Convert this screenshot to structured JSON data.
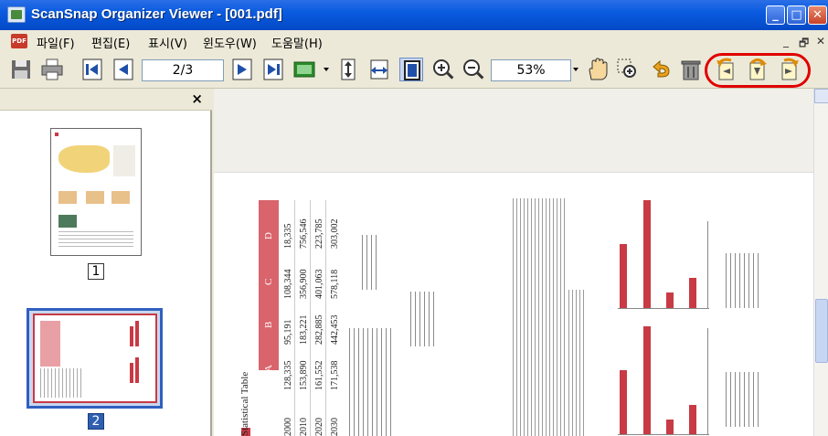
{
  "window": {
    "title": "ScanSnap Organizer Viewer - [001.pdf]",
    "buttons": {
      "minimize": "_",
      "maximize": "□",
      "close": "✕"
    }
  },
  "menu": {
    "items": [
      "파일(F)",
      "편집(E)",
      "표시(V)",
      "윈도우(W)",
      "도움말(H)"
    ],
    "mdi_buttons": [
      "_",
      "🗗",
      "✕"
    ],
    "pdf_badge": "PDF"
  },
  "toolbar": {
    "page_value": "2/3",
    "zoom_value": "53%",
    "icons": [
      "save-icon",
      "print-icon",
      "first-page-icon",
      "prev-page-icon",
      "next-page-icon",
      "last-page-icon",
      "thumbnail-toggle-icon",
      "fit-height-icon",
      "fit-width-icon",
      "fit-page-icon",
      "zoom-in-icon",
      "zoom-out-icon",
      "hand-icon",
      "marquee-zoom-icon",
      "undo-icon",
      "trash-icon",
      "rotate-left-icon",
      "rotate-180-icon",
      "rotate-right-icon"
    ],
    "highlight_color": "#e00000"
  },
  "thumbnails": {
    "close_label": "×",
    "pages": [
      {
        "label": "1",
        "selected": false
      },
      {
        "label": "2",
        "selected": true
      }
    ]
  },
  "document": {
    "table_title": "Statistical Table",
    "columns": [
      "A",
      "B",
      "C",
      "D"
    ],
    "rows": [
      {
        "year": "2000",
        "values": [
          "128,335",
          "95,191",
          "108,344",
          "18,335"
        ]
      },
      {
        "year": "2010",
        "values": [
          "153,890",
          "183,221",
          "356,900",
          "756,546"
        ]
      },
      {
        "year": "2020",
        "values": [
          "161,552",
          "282,885",
          "401,063",
          "223,785"
        ]
      },
      {
        "year": "2030",
        "values": [
          "171,538",
          "442,453",
          "578,118",
          "303,002"
        ]
      }
    ],
    "accent_color": "#c83a44"
  }
}
